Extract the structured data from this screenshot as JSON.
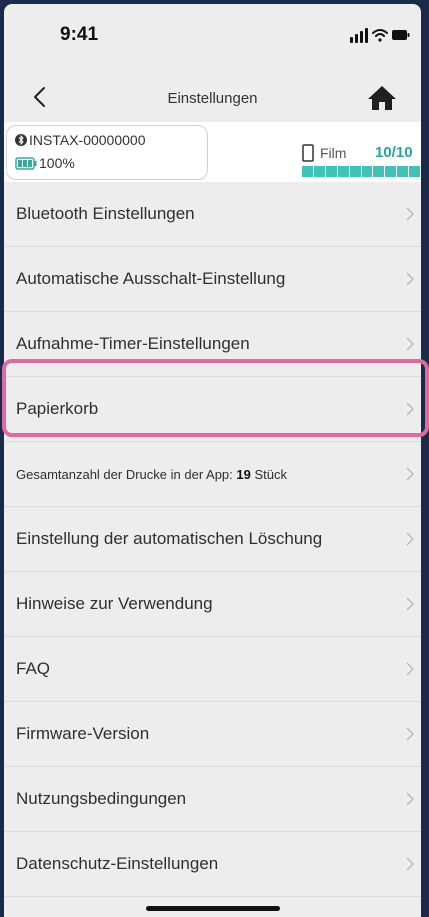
{
  "status_bar": {
    "time": "9:41",
    "icons": [
      "signal-icon",
      "wifi-icon",
      "battery-icon"
    ]
  },
  "nav": {
    "title": "Einstellungen",
    "back_icon": "chevron-left-icon",
    "home_icon": "home-icon"
  },
  "device": {
    "name": "INSTAX-00000000",
    "battery": "100%",
    "film_label": "Film",
    "film_count": "10/10",
    "film_remaining_fraction": 1.0
  },
  "menu": {
    "items": [
      {
        "label": "Bluetooth Einstellungen"
      },
      {
        "label": "Automatische Ausschalt-Einstellung"
      },
      {
        "label": "Aufnahme-Timer-Einstellungen"
      },
      {
        "label": "Papierkorb",
        "highlighted": true
      },
      {
        "label_prefix": "Gesamtanzahl der Drucke in der App:",
        "count": "19",
        "label_suffix": "Stück"
      },
      {
        "label": "Einstellung der automatischen Löschung"
      },
      {
        "label": "Hinweise zur Verwendung"
      },
      {
        "label": "FAQ"
      },
      {
        "label": "Firmware-Version"
      },
      {
        "label": "Nutzungsbedingungen"
      },
      {
        "label": "Datenschutz-Einstellungen"
      }
    ]
  },
  "colors": {
    "accent": "#40c2b6",
    "highlight": "#e0699f",
    "background": "#ededee"
  }
}
